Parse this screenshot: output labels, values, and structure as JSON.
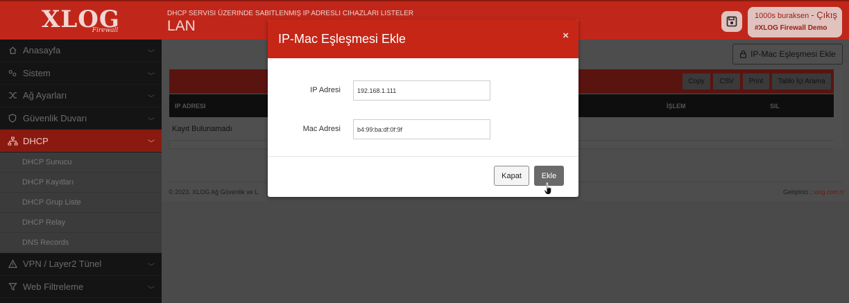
{
  "header": {
    "logo_text": "XLOG",
    "logo_sub": "Firewall",
    "page_description": "DHCP SERVISI ÜZERINDE SABITLENMIŞ IP ADRESLI CIHAZLARI LISTELER",
    "page_title": "LAN",
    "user_text": "1000s buraksen",
    "logout_label": "- Çıkış",
    "instance_name": "#XLOG Firewall Demo"
  },
  "sidebar": {
    "items": [
      {
        "label": "Anasayfa",
        "icon": "home-icon"
      },
      {
        "label": "Sistem",
        "icon": "settings-icon"
      },
      {
        "label": "Ağ Ayarları",
        "icon": "shuffle-icon"
      },
      {
        "label": "Güvenlik Duvarı",
        "icon": "shield-icon"
      },
      {
        "label": "DHCP",
        "icon": "sitemap-icon"
      }
    ],
    "dhcp_sub": [
      "DHCP Sunucu",
      "DHCP Kayıtları",
      "DHCP Grup Liste",
      "DHCP Relay",
      "DNS Records"
    ],
    "items_after": [
      {
        "label": "VPN / Layer2 Tünel",
        "icon": "warning-icon"
      },
      {
        "label": "Web Filtreleme",
        "icon": "filter-icon"
      }
    ]
  },
  "content": {
    "add_mapping_label": "IP-Mac Eşleşmesi Ekle",
    "toolbar": {
      "copy": "Copy",
      "csv": "CSV",
      "print": "Print",
      "search": "Tablo İçi Arama"
    },
    "columns": {
      "ip": "IP ADRESI",
      "action": "İŞLEM",
      "delete": "SIL"
    },
    "empty_text": "Kayıt Bulunamadı",
    "footer_left": "© 2023. XLOG Ağ Güvenlik ve L",
    "footer_right_label": "Geliştirici :",
    "footer_right_link": "xlog.com.tr"
  },
  "modal": {
    "title": "IP-Mac Eşleşmesi Ekle",
    "close_symbol": "×",
    "ip_label": "IP Adresi",
    "ip_value": "192.168.1.111",
    "mac_label": "Mac Adresi",
    "mac_value": "b4:99:ba:df:0f:9f",
    "cancel_label": "Kapat",
    "submit_label": "Ekle"
  },
  "colors": {
    "brand_red": "#c52616",
    "sidebar_bg": "#141414"
  }
}
